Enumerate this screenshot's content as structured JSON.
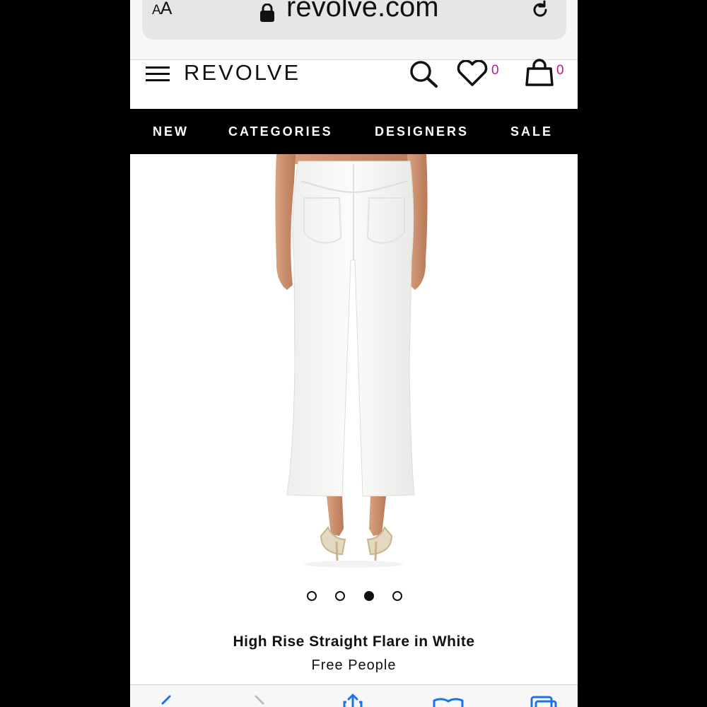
{
  "browser": {
    "aa_label_small": "A",
    "aa_label_large": "A",
    "url": "revolve.com",
    "lock_icon": "lock-icon",
    "reload_icon": "reload-icon"
  },
  "header": {
    "logo": "REVOLVE",
    "menu_icon": "hamburger-icon",
    "search_icon": "search-icon",
    "wishlist_icon": "heart-icon",
    "wishlist_count": "0",
    "bag_icon": "bag-icon",
    "bag_count": "0",
    "badge_color": "#c0188c"
  },
  "nav": {
    "items": [
      "NEW",
      "CATEGORIES",
      "DESIGNERS",
      "SALE"
    ]
  },
  "product": {
    "carousel_total": 4,
    "carousel_active": 3,
    "name": "High Rise Straight Flare in White",
    "brand": "Free People"
  },
  "toolbar": {
    "icons": [
      "back-icon",
      "forward-icon",
      "share-icon",
      "bookmarks-icon",
      "tabs-icon"
    ],
    "tint": "#1a73e8"
  }
}
